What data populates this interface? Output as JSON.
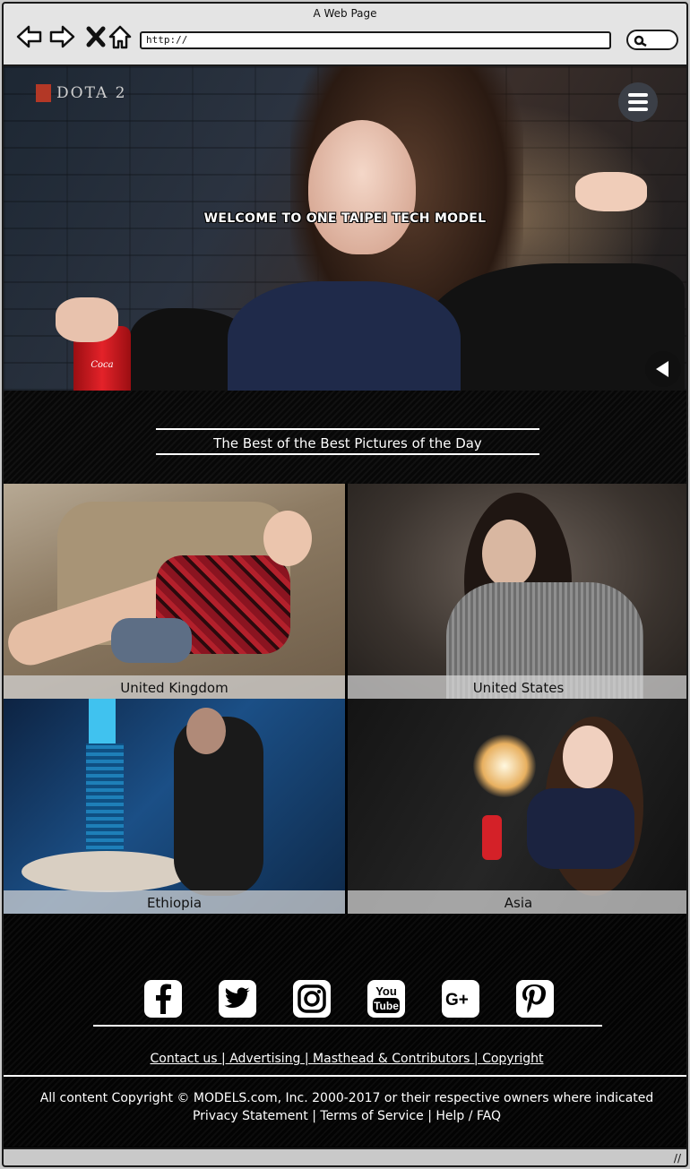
{
  "browser": {
    "window_title": "A Web Page",
    "url": "http://"
  },
  "hero": {
    "logo_text": "DOTA 2",
    "welcome_text": "WELCOME TO ONE TAIPEI TECH MODEL"
  },
  "section": {
    "headline": "The Best of the Best Pictures of the Day"
  },
  "gallery": {
    "tiles": [
      {
        "caption": "United Kingdom"
      },
      {
        "caption": "United States"
      },
      {
        "caption": "Ethiopia"
      },
      {
        "caption": "Asia"
      }
    ]
  },
  "footer": {
    "social": [
      "facebook-icon",
      "twitter-icon",
      "instagram-icon",
      "youtube-icon",
      "google-plus-icon",
      "pinterest-icon"
    ],
    "links_line": "Contact us | Advertising | Masthead & Contributors | Copyright",
    "copyright_line1": "All content Copyright © MODELS.com, Inc. 2000-2017 or their respective owners where indicated",
    "copyright_line2": "Privacy Statement | Terms of Service | Help / FAQ"
  }
}
